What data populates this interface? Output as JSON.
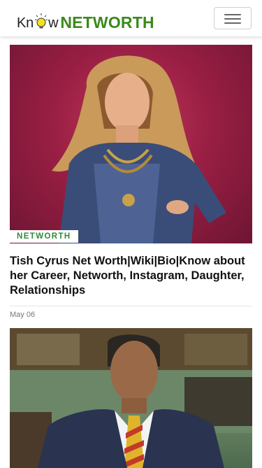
{
  "header": {
    "logo_know": "Kn",
    "logo_w": "w",
    "logo_networth": "NETWORTH",
    "menu_icon": "hamburger-menu-icon"
  },
  "articles": [
    {
      "category": "NETWORTH",
      "title": "Tish Cyrus Net Worth|Wiki|Bio|Know about her Career, Networth, Instagram, Daughter, Relationships",
      "date": "May 06"
    }
  ],
  "colors": {
    "brand_green": "#3a8a1c",
    "category_green": "#2e8b3a"
  }
}
